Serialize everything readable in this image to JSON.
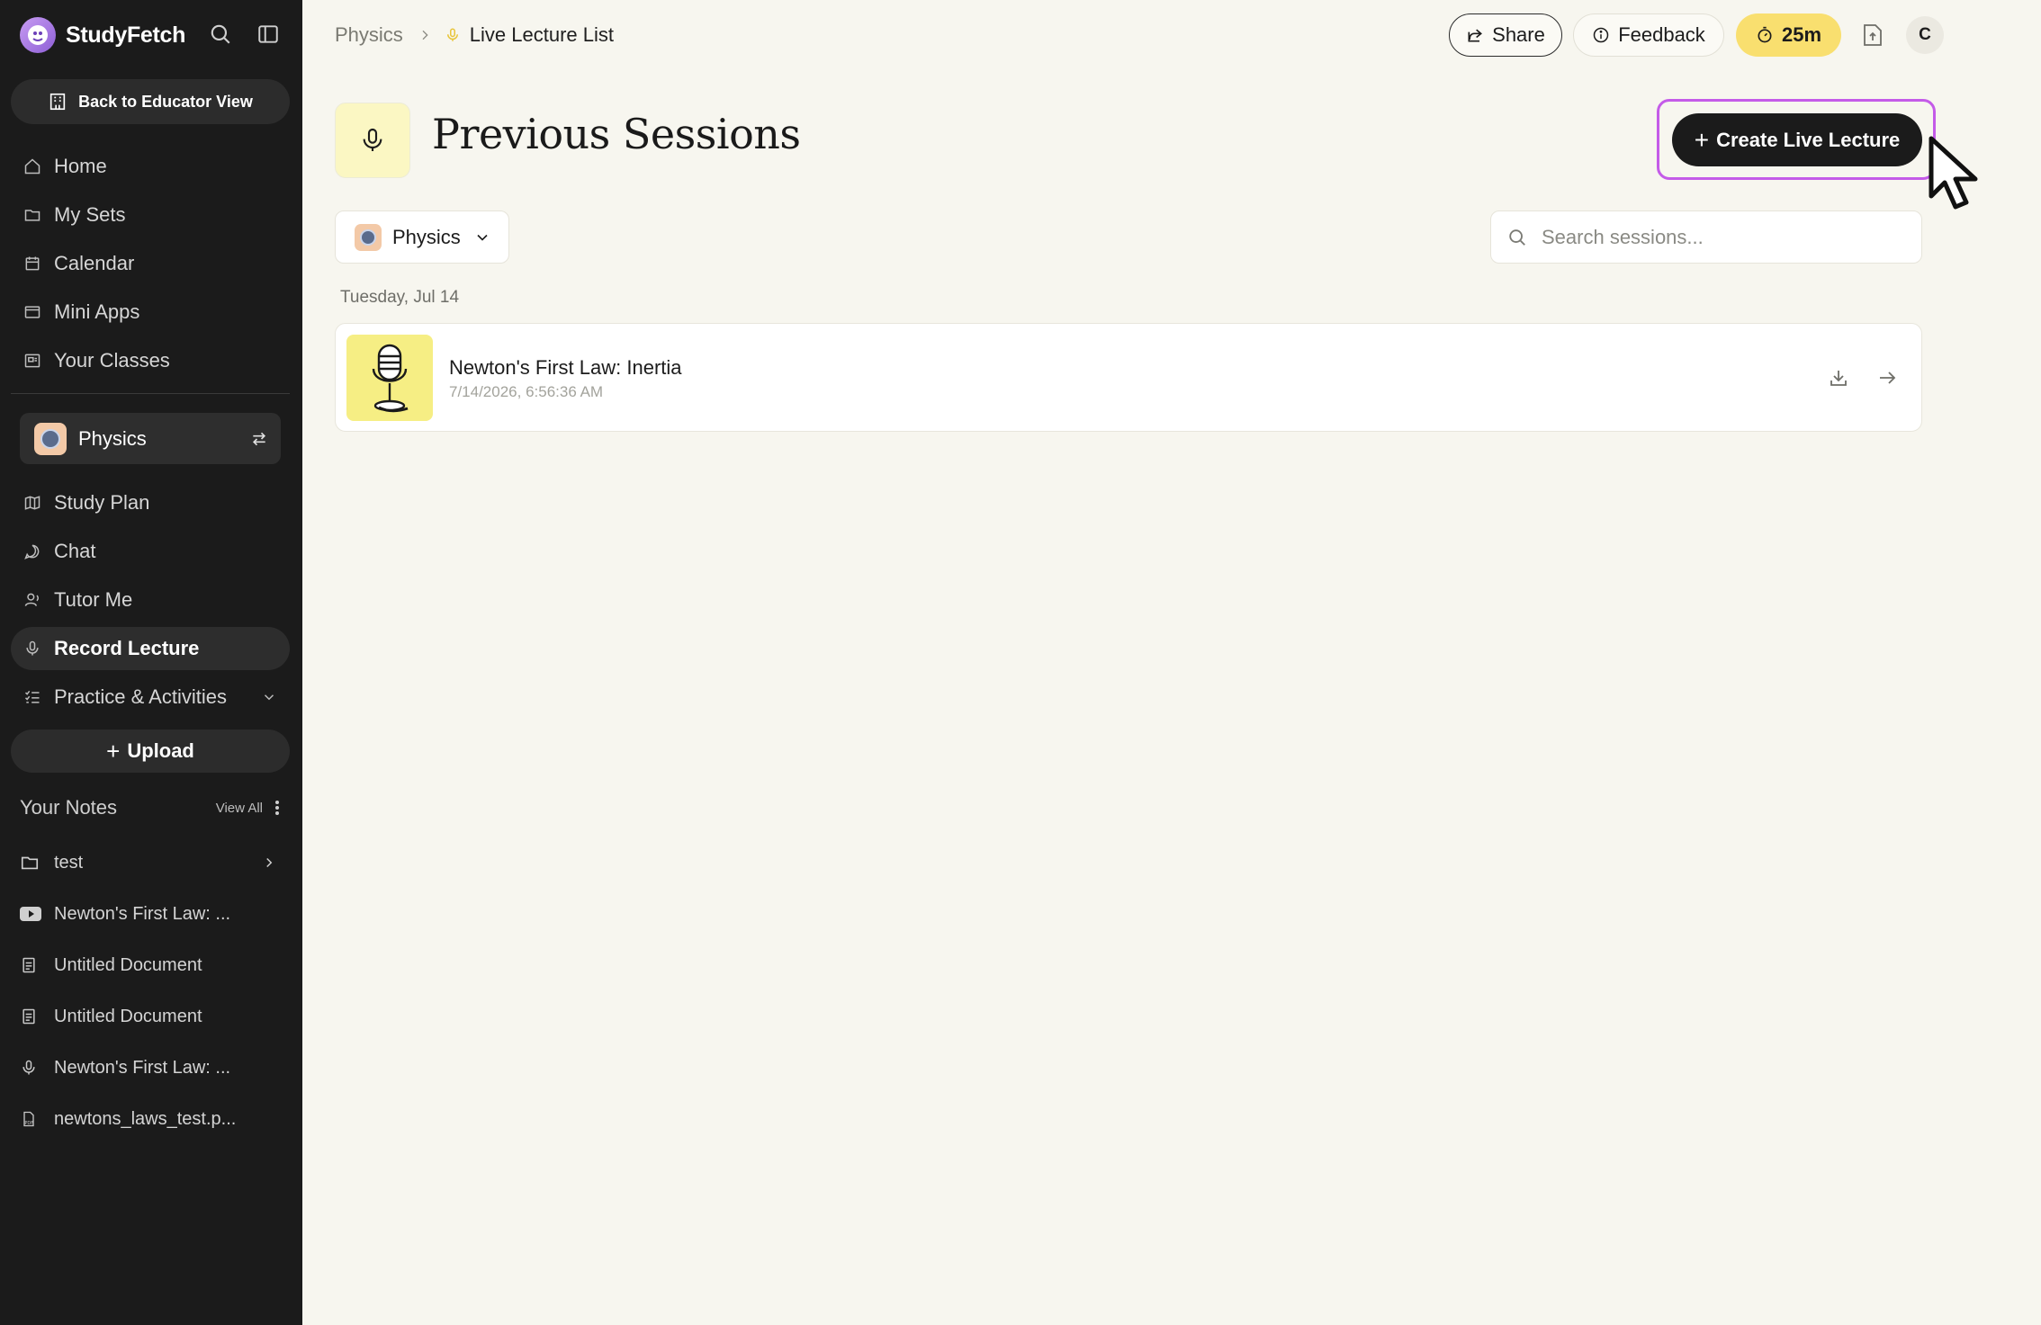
{
  "app": {
    "name": "StudyFetch",
    "accent": "#c45be8",
    "timer_color": "#f9df6f"
  },
  "sidebar": {
    "search_icon": "search-icon",
    "toggle_icon": "sidebar-toggle-icon",
    "educator_button": "Back to Educator View",
    "nav": [
      {
        "label": "Home",
        "icon": "home-icon"
      },
      {
        "label": "My Sets",
        "icon": "folder-icon"
      },
      {
        "label": "Calendar",
        "icon": "calendar-icon"
      },
      {
        "label": "Mini Apps",
        "icon": "window-icon"
      },
      {
        "label": "Your Classes",
        "icon": "classes-icon"
      }
    ],
    "current_class": "Physics",
    "class_nav": [
      {
        "label": "Study Plan",
        "icon": "map-icon"
      },
      {
        "label": "Chat",
        "icon": "chat-icon"
      },
      {
        "label": "Tutor Me",
        "icon": "tutor-icon"
      },
      {
        "label": "Record Lecture",
        "icon": "mic-icon",
        "active": true
      },
      {
        "label": "Practice & Activities",
        "icon": "list-icon"
      }
    ],
    "upload_label": "Upload",
    "notes_title": "Your Notes",
    "notes_view_all": "View All",
    "notes": [
      {
        "label": "test",
        "icon": "folder-icon"
      },
      {
        "label": "Newton's First Law: ...",
        "icon": "youtube-icon"
      },
      {
        "label": "Untitled Document",
        "icon": "document-icon"
      },
      {
        "label": "Untitled Document",
        "icon": "document-icon"
      },
      {
        "label": "Newton's First Law: ...",
        "icon": "mic-icon"
      },
      {
        "label": "newtons_laws_test.p...",
        "icon": "pdf-icon"
      }
    ]
  },
  "header": {
    "breadcrumb_parent": "Physics",
    "breadcrumb_current": "Live Lecture List",
    "share_label": "Share",
    "feedback_label": "Feedback",
    "timer_label": "25m",
    "avatar_initial": "C"
  },
  "main": {
    "title": "Previous Sessions",
    "create_button": "Create Live Lecture",
    "class_filter": "Physics",
    "search_placeholder": "Search sessions...",
    "groups": [
      {
        "date": "Tuesday, Jul 14",
        "sessions": [
          {
            "title": "Newton's First Law: Inertia",
            "timestamp": "7/14/2026, 6:56:36 AM"
          }
        ]
      }
    ]
  }
}
